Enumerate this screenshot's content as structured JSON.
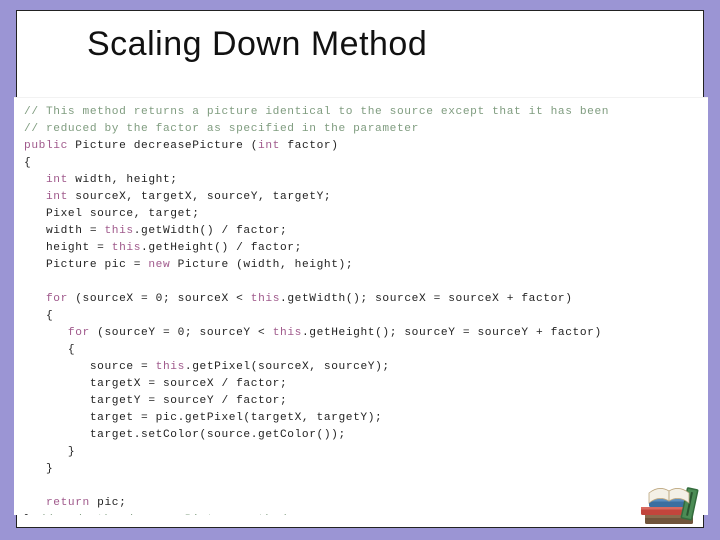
{
  "slide": {
    "title": "Scaling Down Method"
  },
  "code": {
    "lines": [
      {
        "cls": "cm",
        "text": "// This method returns a picture identical to the source except that it has been"
      },
      {
        "cls": "cm",
        "text": "// reduced by the factor as specified in the parameter"
      },
      {
        "cls": "",
        "html": "<span class='kw'>public</span> Picture decreasePicture (<span class='kw'>int</span> factor)"
      },
      {
        "cls": "",
        "text": "{"
      },
      {
        "cls": "",
        "html": "   <span class='kw'>int</span> width, height;"
      },
      {
        "cls": "",
        "html": "   <span class='kw'>int</span> sourceX, targetX, sourceY, targetY;"
      },
      {
        "cls": "",
        "html": "   Pixel source, target;"
      },
      {
        "cls": "",
        "html": "   width = <span class='th'>this</span>.getWidth() / factor;"
      },
      {
        "cls": "",
        "html": "   height = <span class='th'>this</span>.getHeight() / factor;"
      },
      {
        "cls": "",
        "html": "   Picture pic = <span class='nw'>new</span> Picture (width, height);"
      },
      {
        "cls": "",
        "text": ""
      },
      {
        "cls": "",
        "html": "   <span class='kw'>for</span> (sourceX = 0; sourceX &lt; <span class='th'>this</span>.getWidth(); sourceX = sourceX + factor)"
      },
      {
        "cls": "",
        "text": "   {"
      },
      {
        "cls": "",
        "html": "      <span class='kw'>for</span> (sourceY = 0; sourceY &lt; <span class='th'>this</span>.getHeight(); sourceY = sourceY + factor)"
      },
      {
        "cls": "",
        "text": "      {"
      },
      {
        "cls": "",
        "html": "         source = <span class='th'>this</span>.getPixel(sourceX, sourceY);"
      },
      {
        "cls": "",
        "text": "         targetX = sourceX / factor;"
      },
      {
        "cls": "",
        "text": "         targetY = sourceY / factor;"
      },
      {
        "cls": "",
        "text": "         target = pic.getPixel(targetX, targetY);"
      },
      {
        "cls": "",
        "text": "         target.setColor(source.getColor());"
      },
      {
        "cls": "",
        "text": "      }"
      },
      {
        "cls": "",
        "text": "   }"
      },
      {
        "cls": "",
        "text": ""
      },
      {
        "cls": "",
        "html": "   <span class='kw'>return</span> pic;"
      },
      {
        "cls": "",
        "html": "} <span class='cm'>// ends the decreasePicture method</span>"
      }
    ]
  }
}
